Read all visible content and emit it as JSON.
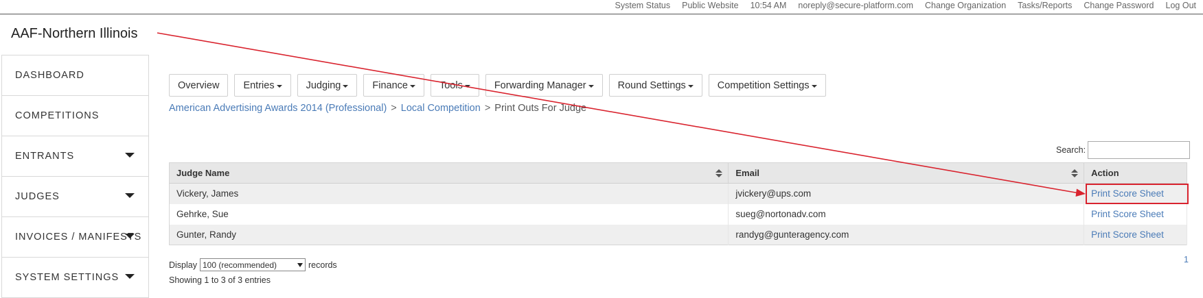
{
  "topbar": {
    "items": [
      "System Status",
      "Public Website",
      "10:54 AM",
      "noreply@secure-platform.com",
      "Change Organization",
      "Tasks/Reports",
      "Change Password",
      "Log Out"
    ]
  },
  "org": {
    "title": "AAF-Northern Illinois"
  },
  "sidebar": {
    "items": [
      {
        "label": "DASHBOARD",
        "has_caret": false
      },
      {
        "label": "COMPETITIONS",
        "has_caret": false
      },
      {
        "label": "ENTRANTS",
        "has_caret": true
      },
      {
        "label": "JUDGES",
        "has_caret": true
      },
      {
        "label": "INVOICES / MANIFESTS",
        "has_caret": true
      },
      {
        "label": "SYSTEM SETTINGS",
        "has_caret": true
      }
    ]
  },
  "tabs": [
    {
      "label": "Overview",
      "dropdown": false
    },
    {
      "label": "Entries",
      "dropdown": true
    },
    {
      "label": "Judging",
      "dropdown": true
    },
    {
      "label": "Finance",
      "dropdown": true
    },
    {
      "label": "Tools",
      "dropdown": true
    },
    {
      "label": "Forwarding Manager",
      "dropdown": true
    },
    {
      "label": "Round Settings",
      "dropdown": true
    },
    {
      "label": "Competition Settings",
      "dropdown": true
    }
  ],
  "breadcrumb": {
    "links": [
      "American Advertising Awards 2014 (Professional)",
      "Local Competition"
    ],
    "current": "Print Outs For Judge",
    "separator": ">"
  },
  "search": {
    "label": "Search:",
    "value": ""
  },
  "table": {
    "headers": [
      "Judge Name",
      "Email",
      "Action"
    ],
    "rows": [
      {
        "name": "Vickery, James",
        "email": "jvickery@ups.com",
        "action": "Print Score Sheet"
      },
      {
        "name": "Gehrke, Sue",
        "email": "sueg@nortonadv.com",
        "action": "Print Score Sheet"
      },
      {
        "name": "Gunter, Randy",
        "email": "randyg@gunteragency.com",
        "action": "Print Score Sheet"
      }
    ]
  },
  "footer": {
    "display_prefix": "Display",
    "display_value": "100 (recommended)",
    "display_suffix": "records",
    "showing": "Showing 1 to 3 of 3 entries",
    "page": "1"
  },
  "colors": {
    "link": "#4a7bb7",
    "annotation": "#d9232e"
  }
}
